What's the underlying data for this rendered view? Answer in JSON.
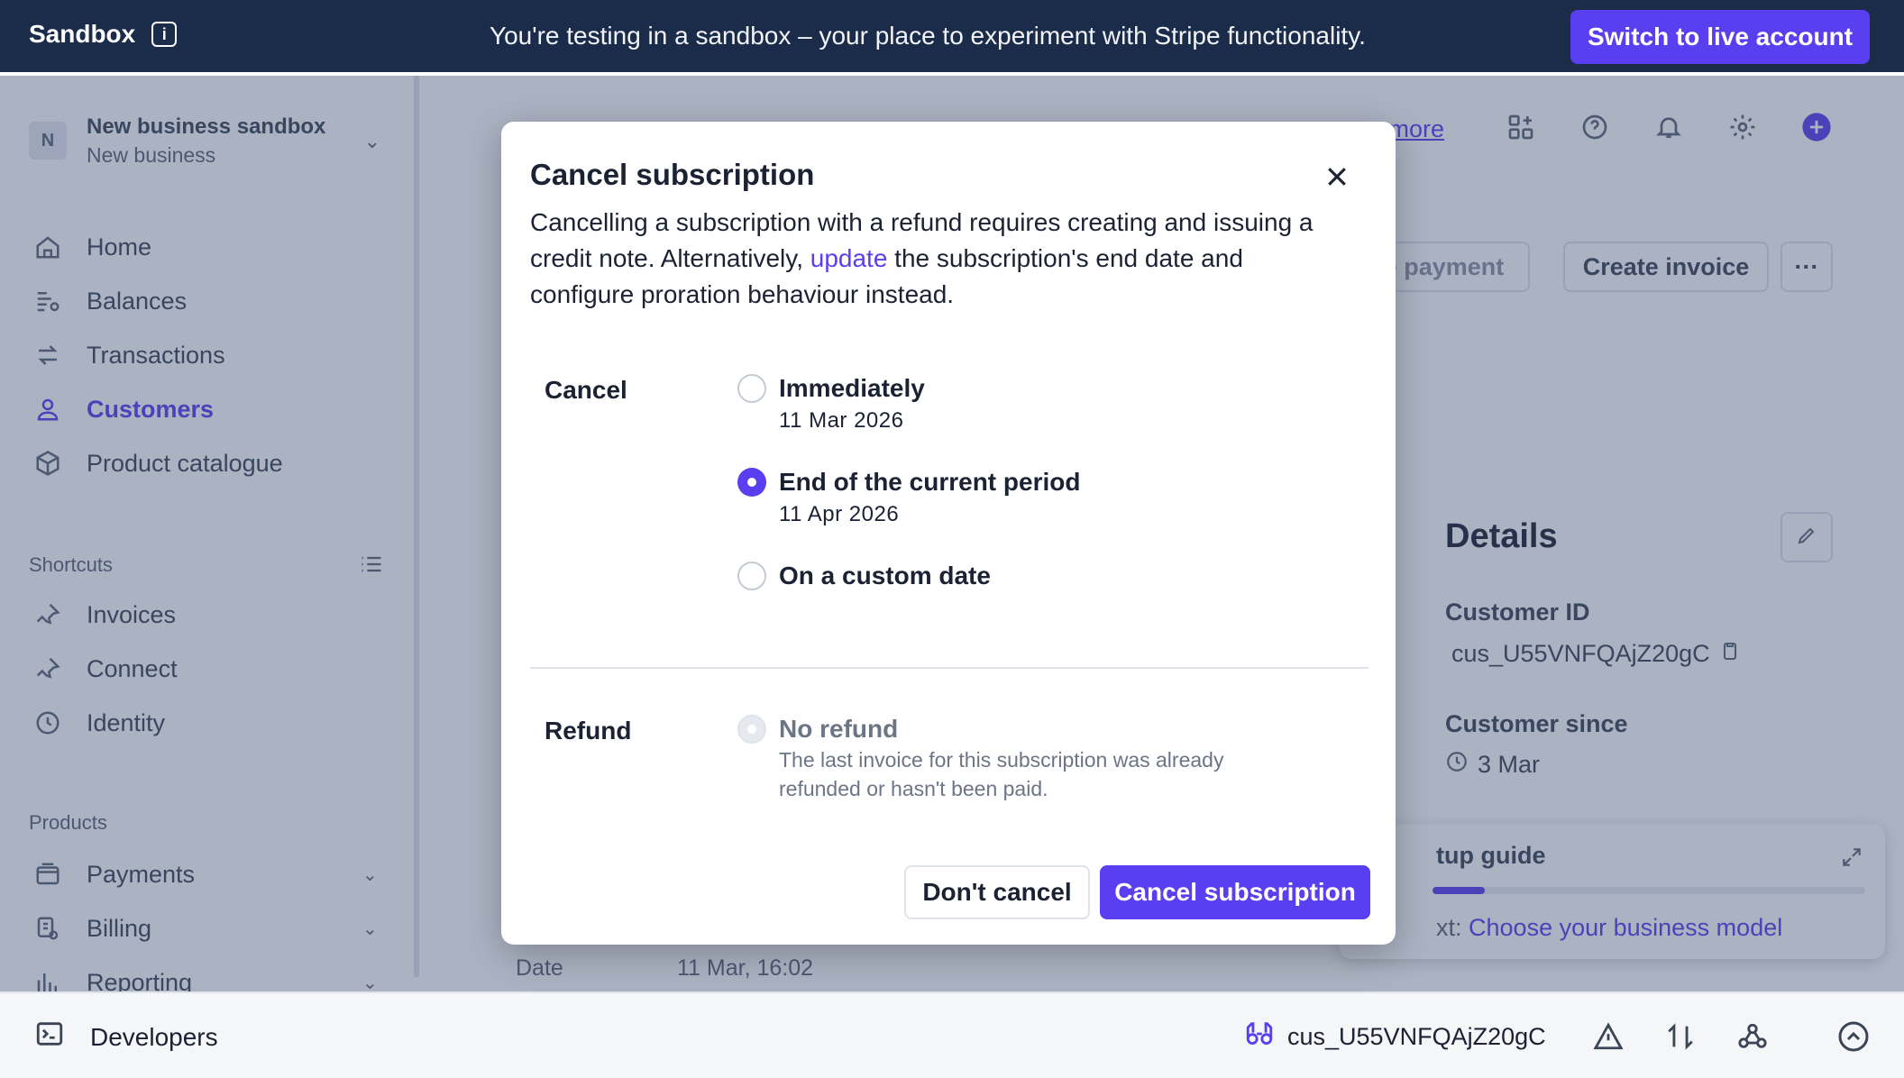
{
  "banner": {
    "brand": "Sandbox",
    "message": "You're testing in a sandbox – your place to experiment with Stripe functionality.",
    "live_button": "Switch to live account"
  },
  "account": {
    "avatar_letter": "N",
    "name": "New business sandbox",
    "sub": "New business"
  },
  "nav": {
    "home": "Home",
    "balances": "Balances",
    "transactions": "Transactions",
    "customers": "Customers",
    "product_catalogue": "Product catalogue",
    "shortcuts_label": "Shortcuts",
    "invoices": "Invoices",
    "connect": "Connect",
    "identity": "Identity",
    "products_label": "Products",
    "payments": "Payments",
    "billing": "Billing",
    "reporting": "Reporting"
  },
  "main": {
    "learn_more": "n more",
    "create_payment": "te payment",
    "create_invoice": "Create invoice",
    "details_heading": "Details",
    "customer_id_label": "Customer ID",
    "customer_id": "cus_U55VNFQAjZ20gC",
    "customer_since_label": "Customer since",
    "customer_since": "3 Mar",
    "setup_title": "tup guide",
    "setup_progress": 0.12,
    "setup_next_prefix": "xt:",
    "setup_next_link": "Choose your business model",
    "date_label": "Date",
    "date_value": "11 Mar, 16:02"
  },
  "devbar": {
    "developers": "Developers",
    "customer_id": "cus_U55VNFQAjZ20gC"
  },
  "modal": {
    "title": "Cancel subscription",
    "desc_before": "Cancelling a subscription with a refund requires creating and issuing a credit note. Alternatively, ",
    "desc_link": "update",
    "desc_after": " the subscription's end date and configure proration behaviour instead.",
    "cancel_label": "Cancel",
    "options": [
      {
        "title": "Immediately",
        "sub": "11 Mar 2026",
        "checked": false
      },
      {
        "title": "End of the current period",
        "sub": "11 Apr 2026",
        "checked": true
      },
      {
        "title": "On a custom date",
        "sub": "",
        "checked": false
      }
    ],
    "refund_label": "Refund",
    "refund_option": {
      "title": "No refund",
      "sub": "The last invoice for this subscription was already refunded or hasn't been paid."
    },
    "dont_cancel": "Don't cancel",
    "confirm": "Cancel subscription"
  },
  "colors": {
    "accent": "#5a3ff1",
    "banner": "#1b2c4b"
  }
}
